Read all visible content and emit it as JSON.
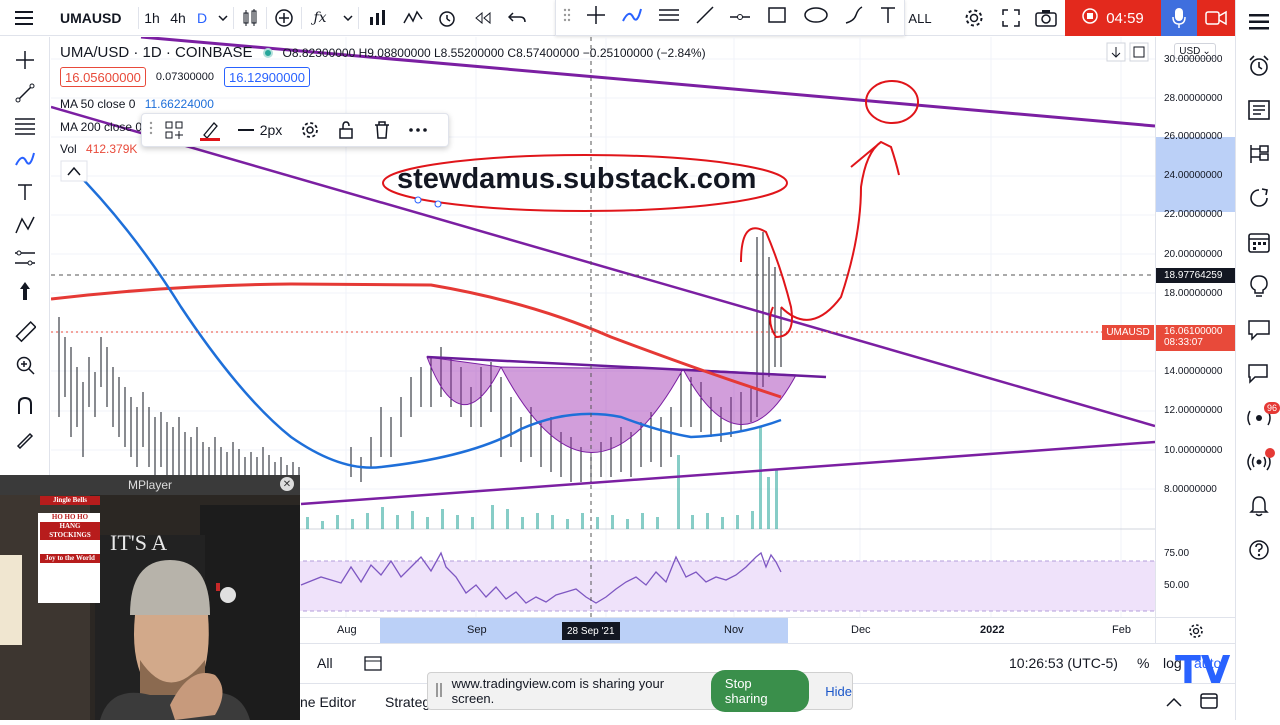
{
  "topbar": {
    "symbol": "UMAUSD",
    "intervals": [
      "1h",
      "4h",
      "D"
    ],
    "active_interval": "D",
    "range_label": "ALL",
    "record_time": "04:59"
  },
  "legend": {
    "title": "UMA/USD · 1D · COINBASE",
    "ohlc": "O8.82300000  H9.08800000  L8.55200000  C8.57400000  −0.25100000 (−2.84%)",
    "bid": "16.05600000",
    "spread": "0.07300000",
    "ask": "16.12900000",
    "ma50_label": "MA 50 close 0",
    "ma50_value": "11.66224000",
    "ma200_label": "MA 200 close 0",
    "vol_label": "Vol",
    "vol_value": "412.379K"
  },
  "annotation": {
    "text": "stewdamus.substack.com"
  },
  "floatbar": {
    "width_label": "2px"
  },
  "price_axis": {
    "currency": "USD",
    "labels": [
      "30.00000000",
      "28.00000000",
      "26.00000000",
      "24.00000000",
      "22.00000000",
      "20.00000000",
      "18.00000000",
      "14.00000000",
      "12.00000000",
      "10.00000000",
      "8.00000000"
    ],
    "crosshair_price": "18.97764259",
    "last_symbol": "UMAUSD",
    "last_price": "16.06100000",
    "countdown": "08:33:07",
    "rsi_labels": [
      "75.00",
      "50.00"
    ]
  },
  "time_axis": {
    "labels": [
      "Aug",
      "Sep",
      "Nov",
      "Dec",
      "2022",
      "Feb"
    ],
    "crosshair_date": "28 Sep '21"
  },
  "bottombar": {
    "range_all": "All",
    "clock": "10:26:53 (UTC-5)",
    "pct": "%",
    "log": "log",
    "auto": "auto"
  },
  "panelbar": {
    "pine_editor": "ne Editor",
    "strategy": "Strateg"
  },
  "share": {
    "message": "www.tradingview.com is sharing your screen.",
    "stop": "Stop sharing",
    "hide": "Hide"
  },
  "mplayer": {
    "title": "MPlayer",
    "sign_lines": [
      "Jingle Bells",
      "HO HO HO",
      "HANG STOCKINGS",
      "Joy to the World"
    ],
    "board_text": "IT'S A"
  },
  "notification_badge": "96",
  "colors": {
    "purple_line": "#7b1fa2",
    "ma200": "#e53935",
    "ma50": "#1e6fd9",
    "annotation_red": "#e0151a",
    "price_label_red": "#e84a3a",
    "rsi_fill": "#e6d6f5"
  }
}
